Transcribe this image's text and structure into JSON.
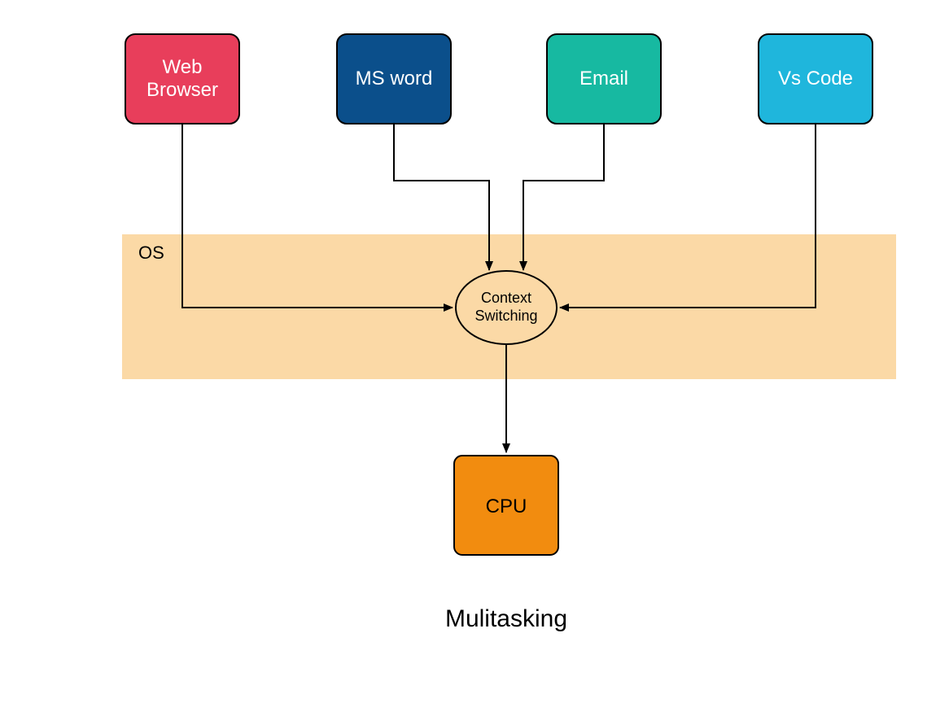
{
  "apps": {
    "web_browser": {
      "label_line1": "Web",
      "label_line2": "Browser",
      "fill": "#e83e5b"
    },
    "ms_word": {
      "label": "MS word",
      "fill": "#0b4f8b"
    },
    "email": {
      "label": "Email",
      "fill": "#17b9a1"
    },
    "vs_code": {
      "label": "Vs Code",
      "fill": "#1fb6dc"
    }
  },
  "os": {
    "label": "OS",
    "fill": "#fbd9a6",
    "context_switching": {
      "line1": "Context",
      "line2": "Switching"
    }
  },
  "cpu": {
    "label": "CPU",
    "fill": "#f28c0f"
  },
  "caption": "Mulitasking",
  "colors": {
    "stroke": "#000000",
    "arrow": "#000000"
  }
}
